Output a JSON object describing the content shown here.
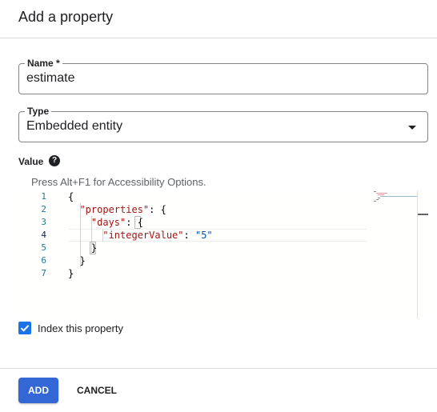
{
  "dialog": {
    "title": "Add a property"
  },
  "name_field": {
    "label": "Name *",
    "value": "estimate"
  },
  "type_field": {
    "label": "Type",
    "value": "Embedded entity"
  },
  "value_section": {
    "label": "Value",
    "help_icon": "help-icon",
    "a11y_hint": "Press Alt+F1 for Accessibility Options."
  },
  "editor": {
    "line_numbers": [
      "1",
      "2",
      "3",
      "4",
      "5",
      "6",
      "7"
    ],
    "active_line": 4,
    "lines": [
      "{",
      "  \"properties\": {",
      "    \"days\": {",
      "      \"integerValue\": \"5\"",
      "    }",
      "  }",
      "}"
    ]
  },
  "index_checkbox": {
    "label": "Index this property",
    "checked": true
  },
  "actions": {
    "add_label": "ADD",
    "cancel_label": "CANCEL"
  },
  "colors": {
    "accent": "#3367d6",
    "checkbox": "#1a73e8",
    "json_key": "#a31515",
    "json_string": "#0451a5",
    "line_number": "#237893"
  }
}
